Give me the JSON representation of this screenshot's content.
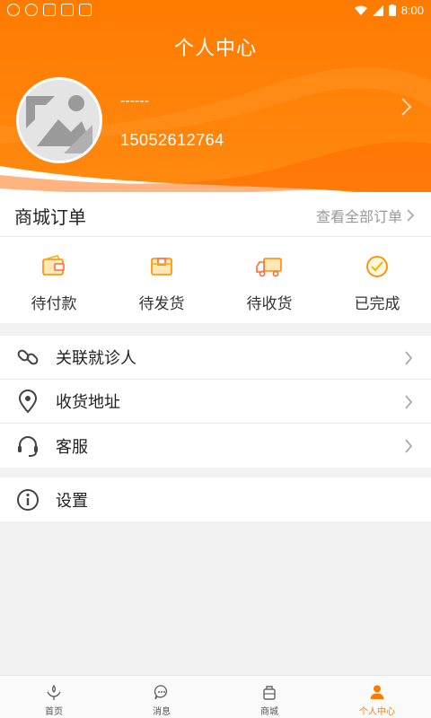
{
  "status_bar": {
    "time": "8:00"
  },
  "header": {
    "title": "个人中心",
    "username": "------",
    "phone": "15052612764"
  },
  "orders": {
    "title": "商城订单",
    "view_all": "查看全部订单",
    "items": [
      {
        "label": "待付款",
        "icon": "wallet-icon"
      },
      {
        "label": "待发货",
        "icon": "box-icon"
      },
      {
        "label": "待收货",
        "icon": "truck-icon"
      },
      {
        "label": "已完成",
        "icon": "check-circle-icon"
      }
    ]
  },
  "menu": {
    "items": [
      {
        "label": "关联就诊人",
        "icon": "link-icon"
      },
      {
        "label": "收货地址",
        "icon": "location-pin-icon"
      },
      {
        "label": "客服",
        "icon": "headset-icon"
      }
    ],
    "settings": {
      "label": "设置",
      "icon": "info-icon"
    }
  },
  "bottom_nav": {
    "items": [
      {
        "label": "首页",
        "icon": "home-icon",
        "active": false
      },
      {
        "label": "消息",
        "icon": "message-icon",
        "active": false
      },
      {
        "label": "商城",
        "icon": "shop-icon",
        "active": false
      },
      {
        "label": "个人中心",
        "icon": "person-icon",
        "active": true
      }
    ]
  },
  "colors": {
    "accent": "#ff7a00",
    "accent_light": "#ff9a1f"
  }
}
